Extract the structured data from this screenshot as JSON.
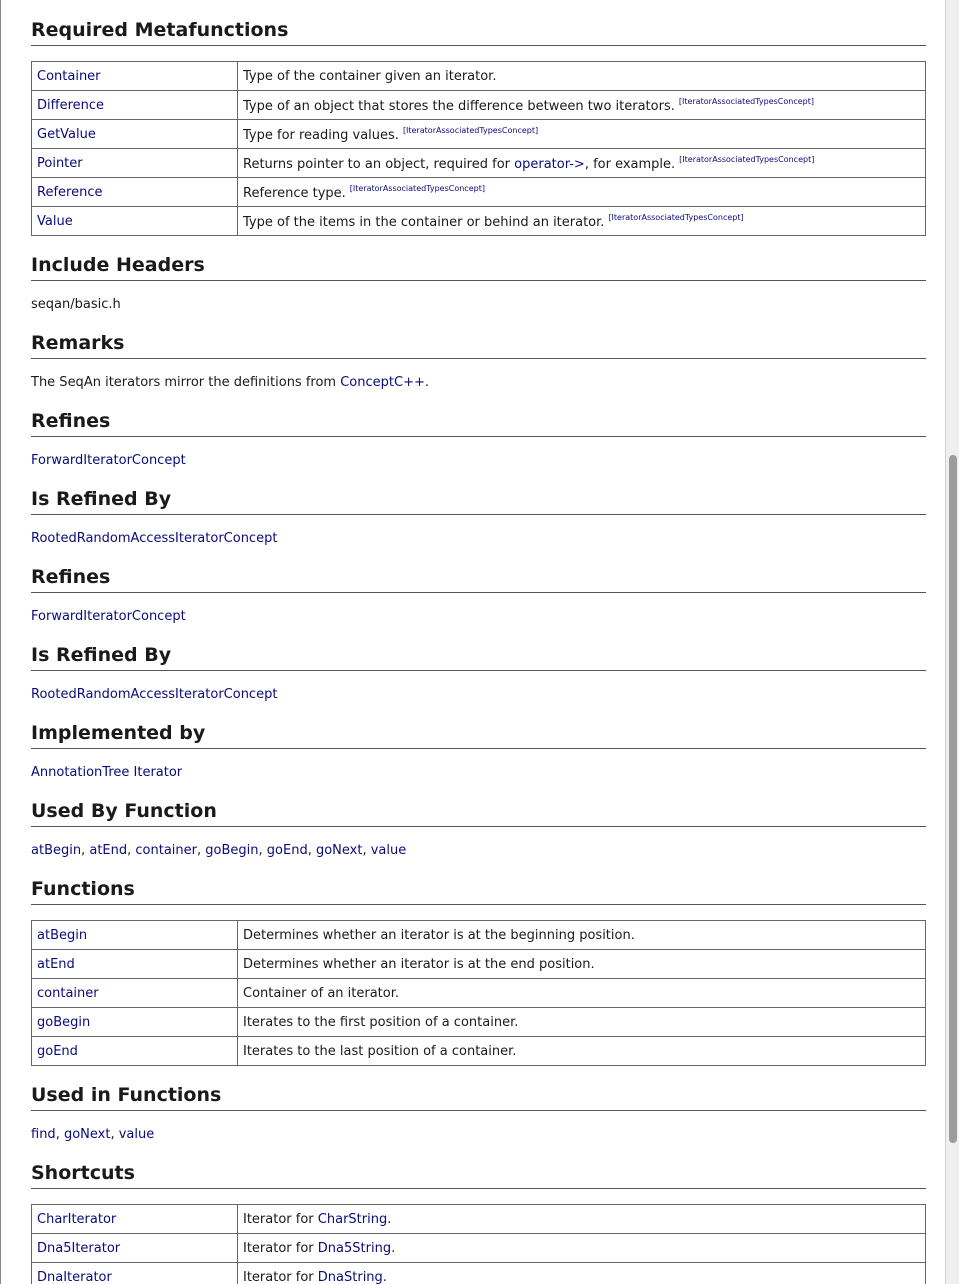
{
  "metafunctions": {
    "heading": "Required Metafunctions",
    "rows": [
      {
        "name": "Container",
        "desc": "Type of the container given an iterator.",
        "ref": ""
      },
      {
        "name": "Difference",
        "desc": "Type of an object that stores the difference between two iterators.",
        "ref": "[IteratorAssociatedTypesConcept]"
      },
      {
        "name": "GetValue",
        "desc": "Type for reading values.",
        "ref": "[IteratorAssociatedTypesConcept]"
      },
      {
        "name": "Pointer",
        "desc_pre": "Returns pointer to an object, required for ",
        "desc_link": "operator->",
        "desc_post": ", for example.",
        "ref": "[IteratorAssociatedTypesConcept]"
      },
      {
        "name": "Reference",
        "desc": "Reference type.",
        "ref": "[IteratorAssociatedTypesConcept]"
      },
      {
        "name": "Value",
        "desc": "Type of the items in the container or behind an iterator.",
        "ref": "[IteratorAssociatedTypesConcept]"
      }
    ]
  },
  "include_headers": {
    "heading": "Include Headers",
    "text": "seqan/basic.h"
  },
  "remarks": {
    "heading": "Remarks",
    "text_pre": "The SeqAn iterators mirror the definitions from ",
    "link": "ConceptC++",
    "text_post": "."
  },
  "refines_1": {
    "heading": "Refines",
    "link": "ForwardIteratorConcept"
  },
  "refined_by_1": {
    "heading": "Is Refined By",
    "link": "RootedRandomAccessIteratorConcept"
  },
  "refines_2": {
    "heading": "Refines",
    "link": "ForwardIteratorConcept"
  },
  "refined_by_2": {
    "heading": "Is Refined By",
    "link": "RootedRandomAccessIteratorConcept"
  },
  "implemented_by": {
    "heading": "Implemented by",
    "link": "AnnotationTree Iterator"
  },
  "used_by_function": {
    "heading": "Used By Function",
    "links": [
      "atBegin",
      "atEnd",
      "container",
      "goBegin",
      "goEnd",
      "goNext",
      "value"
    ],
    "separator": ", "
  },
  "functions": {
    "heading": "Functions",
    "rows": [
      {
        "name": "atBegin",
        "desc": "Determines whether an iterator is at the beginning position."
      },
      {
        "name": "atEnd",
        "desc": "Determines whether an iterator is at the end position."
      },
      {
        "name": "container",
        "desc": "Container of an iterator."
      },
      {
        "name": "goBegin",
        "desc": "Iterates to the first position of a container."
      },
      {
        "name": "goEnd",
        "desc": "Iterates to the last position of a container."
      }
    ]
  },
  "used_in_functions": {
    "heading": "Used in Functions",
    "links": [
      "find",
      "goNext",
      "value"
    ],
    "separator": ", "
  },
  "shortcuts": {
    "heading": "Shortcuts",
    "rows": [
      {
        "name": "CharIterator",
        "desc_pre": "Iterator for ",
        "desc_link": "CharString",
        "desc_post": "."
      },
      {
        "name": "Dna5Iterator",
        "desc_pre": "Iterator for ",
        "desc_link": "Dna5String",
        "desc_post": "."
      },
      {
        "name": "DnaIterator",
        "desc_pre": "Iterator for ",
        "desc_link": "DnaString",
        "desc_post": "."
      }
    ]
  },
  "colors": {
    "link": "#0b0b7a",
    "text": "#1a1a1a",
    "border": "#666666"
  }
}
